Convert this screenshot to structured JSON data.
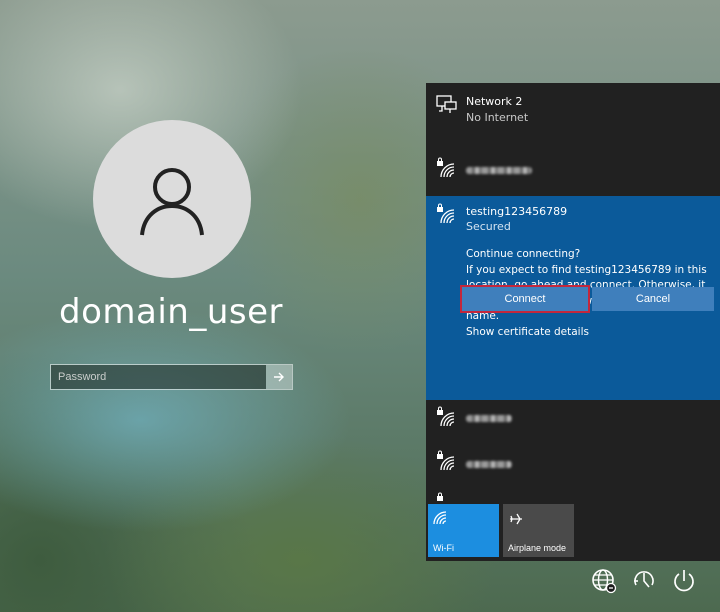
{
  "login": {
    "username": "domain_user",
    "password_placeholder": "Password"
  },
  "network_flyout": {
    "networks": [
      {
        "name": "Network 2",
        "status": "No Internet"
      },
      {
        "name": "",
        "status": ""
      },
      {
        "name": "testing123456789",
        "status": "Secured"
      },
      {
        "name": "",
        "status": ""
      },
      {
        "name": "",
        "status": ""
      },
      {
        "name": "",
        "status": ""
      }
    ],
    "prompt": {
      "heading": "Continue connecting?",
      "message": "If you expect to find testing123456789 in this location, go ahead and connect. Otherwise, it may be a different network with the same name.",
      "link": "Show certificate details",
      "connect_label": "Connect",
      "cancel_label": "Cancel"
    },
    "quick_actions": [
      {
        "label": "Wi-Fi",
        "active": true
      },
      {
        "label": "Airplane mode",
        "active": false
      }
    ]
  },
  "colors": {
    "flyout_bg": "#212121",
    "selected_bg": "#0b5a9a",
    "button_bg": "#3f7fbc",
    "highlight_border": "#c3273c",
    "active_tile": "#1c8ee0"
  },
  "icons": [
    "user-icon",
    "arrow-right-icon",
    "ethernet-icon",
    "wifi-lock-icon",
    "airplane-icon",
    "network-globe-icon",
    "ease-of-access-icon",
    "power-icon"
  ]
}
